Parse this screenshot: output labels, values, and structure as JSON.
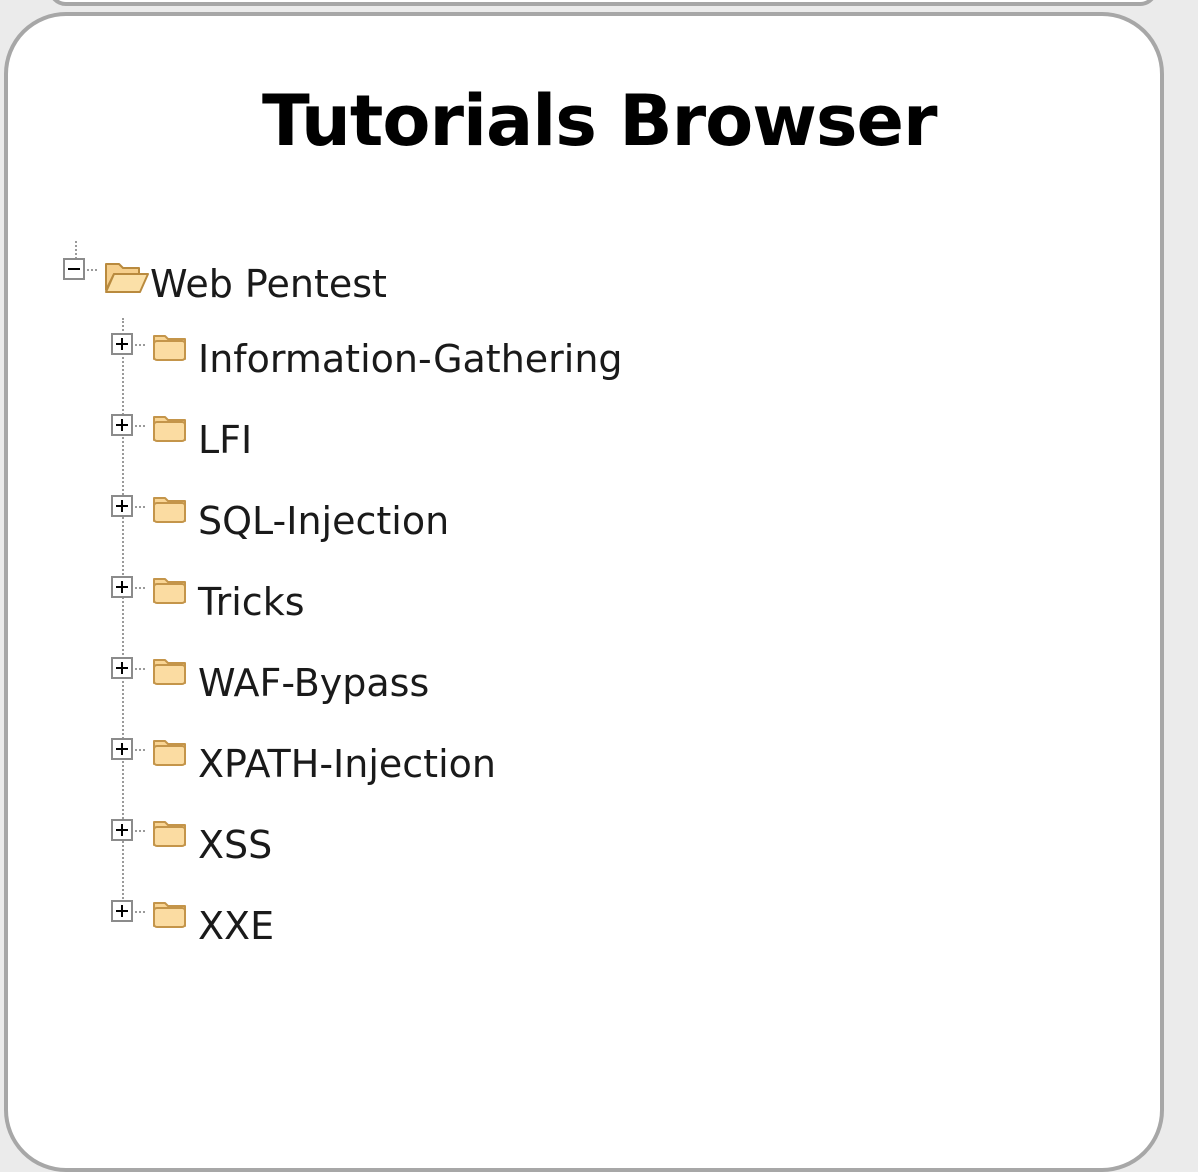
{
  "page": {
    "title": "Tutorials Browser"
  },
  "tree": {
    "root": {
      "label": "Web Pentest",
      "state": "expanded",
      "icon": "folder-open-icon"
    },
    "children": [
      {
        "label": "Information-Gathering",
        "state": "collapsed",
        "icon": "folder-icon"
      },
      {
        "label": "LFI",
        "state": "collapsed",
        "icon": "folder-icon"
      },
      {
        "label": "SQL-Injection",
        "state": "collapsed",
        "icon": "folder-icon"
      },
      {
        "label": "Tricks",
        "state": "collapsed",
        "icon": "folder-icon"
      },
      {
        "label": "WAF-Bypass",
        "state": "collapsed",
        "icon": "folder-icon"
      },
      {
        "label": "XPATH-Injection",
        "state": "collapsed",
        "icon": "folder-icon"
      },
      {
        "label": "XSS",
        "state": "collapsed",
        "icon": "folder-icon"
      },
      {
        "label": "XXE",
        "state": "collapsed",
        "icon": "folder-icon"
      }
    ]
  },
  "colors": {
    "panel_border": "#a7a7a7",
    "folder_fill": "#f9d594",
    "folder_stroke": "#c4954a"
  }
}
